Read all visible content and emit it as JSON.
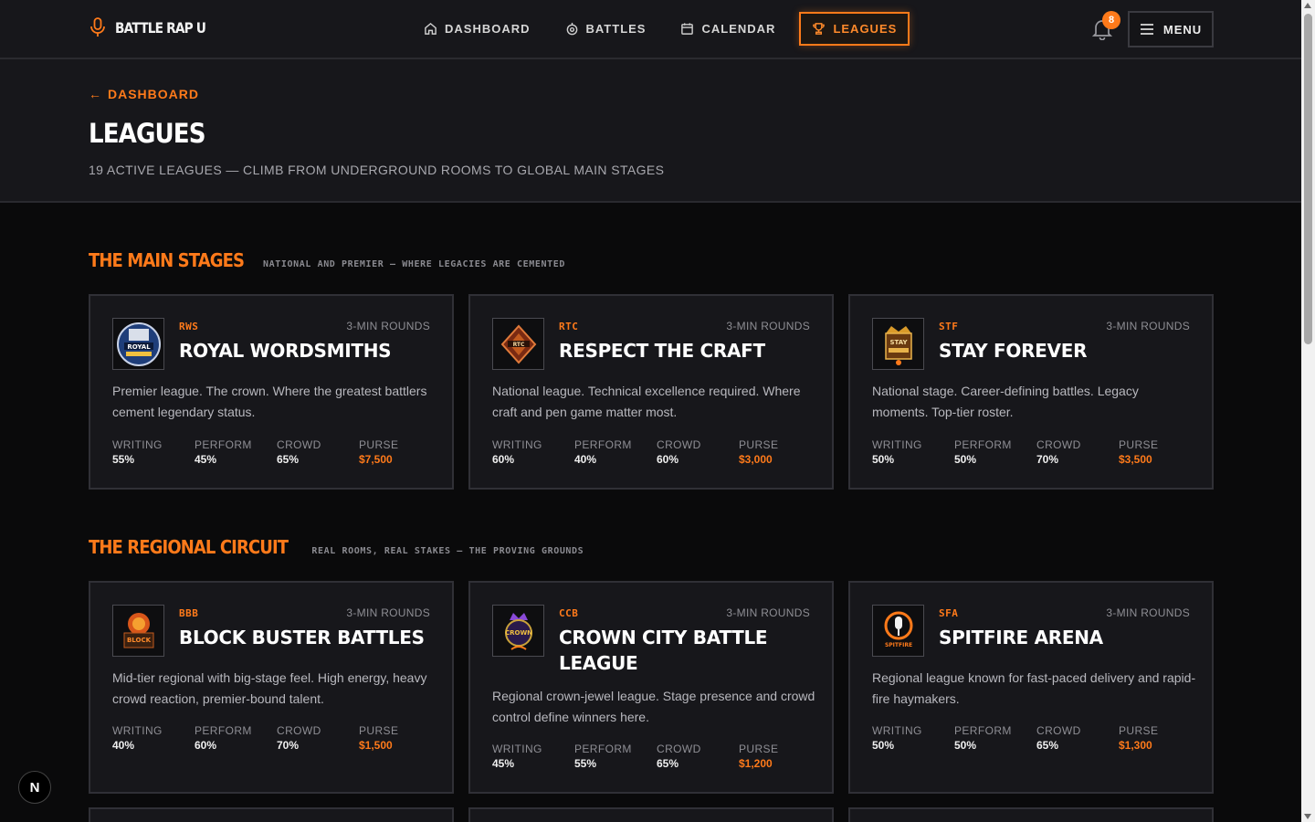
{
  "brand": {
    "name": "BATTLE RAP U"
  },
  "nav": [
    {
      "label": "DASHBOARD",
      "icon": "home-icon"
    },
    {
      "label": "BATTLES",
      "icon": "target-icon"
    },
    {
      "label": "CALENDAR",
      "icon": "calendar-icon"
    },
    {
      "label": "LEAGUES",
      "icon": "trophy-icon",
      "active": true
    }
  ],
  "notifications": {
    "count": "8"
  },
  "menu": {
    "label": "MENU"
  },
  "hero": {
    "back": "DASHBOARD",
    "title": "LEAGUES",
    "subtitle": "19 ACTIVE LEAGUES — CLIMB FROM UNDERGROUND ROOMS TO GLOBAL MAIN STAGES"
  },
  "stat_labels": {
    "writing": "WRITING",
    "perform": "PERFORM",
    "crowd": "CROWD",
    "purse": "PURSE"
  },
  "sections": [
    {
      "title": "THE MAIN STAGES",
      "subtitle": "NATIONAL AND PREMIER — WHERE LEGACIES ARE CEMENTED",
      "cards": [
        {
          "abbr": "RWS",
          "rounds": "3-MIN ROUNDS",
          "name": "ROYAL WORDSMITHS",
          "desc": "Premier league. The crown. Where the greatest battlers cement legendary status.",
          "writing": "55%",
          "perform": "45%",
          "crowd": "65%",
          "purse": "$7,500",
          "logo_text": "ROYAL"
        },
        {
          "abbr": "RTC",
          "rounds": "3-MIN ROUNDS",
          "name": "RESPECT THE CRAFT",
          "desc": "National league. Technical excellence required. Where craft and pen game matter most.",
          "writing": "60%",
          "perform": "40%",
          "crowd": "60%",
          "purse": "$3,000",
          "logo_text": "RTC"
        },
        {
          "abbr": "STF",
          "rounds": "3-MIN ROUNDS",
          "name": "STAY FOREVER",
          "desc": "National stage. Career-defining battles. Legacy moments. Top-tier roster.",
          "writing": "50%",
          "perform": "50%",
          "crowd": "70%",
          "purse": "$3,500",
          "logo_text": "STAY"
        }
      ]
    },
    {
      "title": "THE REGIONAL CIRCUIT",
      "subtitle": "REAL ROOMS, REAL STAKES — THE PROVING GROUNDS",
      "cards": [
        {
          "abbr": "BBB",
          "rounds": "3-MIN ROUNDS",
          "name": "BLOCK BUSTER BATTLES",
          "desc": "Mid-tier regional with big-stage feel. High energy, heavy crowd reaction, premier-bound talent.",
          "writing": "40%",
          "perform": "60%",
          "crowd": "70%",
          "purse": "$1,500",
          "logo_text": "BLOCK"
        },
        {
          "abbr": "CCB",
          "rounds": "3-MIN ROUNDS",
          "name": "CROWN CITY BATTLE LEAGUE",
          "desc": "Regional crown-jewel league. Stage presence and crowd control define winners here.",
          "writing": "45%",
          "perform": "55%",
          "crowd": "65%",
          "purse": "$1,200",
          "logo_text": "CROWN"
        },
        {
          "abbr": "SFA",
          "rounds": "3-MIN ROUNDS",
          "name": "SPITFIRE ARENA",
          "desc": "Regional league known for fast-paced delivery and rapid-fire haymakers.",
          "writing": "50%",
          "perform": "50%",
          "crowd": "65%",
          "purse": "$1,300",
          "logo_text": "SPITFIRE"
        }
      ]
    }
  ],
  "dev_badge": {
    "label": "N"
  },
  "colors": {
    "accent": "#ff7a1a",
    "card_bg": "#17171b",
    "page_bg": "#0a0a0b"
  }
}
